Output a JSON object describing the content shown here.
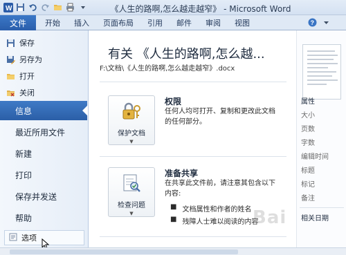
{
  "window": {
    "title": "《人生的路啊,怎么越走越窄》 - Microsoft Word"
  },
  "quick_access": [
    {
      "icon": "word-app-icon"
    },
    {
      "icon": "save-icon"
    },
    {
      "icon": "undo-icon"
    },
    {
      "icon": "redo-icon"
    },
    {
      "icon": "open-folder-icon"
    },
    {
      "icon": "print-icon"
    },
    {
      "icon": "customize-dropdown-icon"
    }
  ],
  "ribbon": {
    "file_tab": "文件",
    "tabs": [
      "开始",
      "插入",
      "页面布局",
      "引用",
      "邮件",
      "审阅",
      "视图"
    ]
  },
  "backstage_nav": {
    "commands": [
      {
        "label": "保存",
        "icon": "save-icon"
      },
      {
        "label": "另存为",
        "icon": "save-as-icon"
      },
      {
        "label": "打开",
        "icon": "open-folder-icon"
      },
      {
        "label": "关闭",
        "icon": "close-doc-icon"
      }
    ],
    "items": [
      "信息",
      "最近所用文件",
      "新建",
      "打印",
      "保存并发送",
      "帮助"
    ],
    "active": "信息",
    "options_label": "选项"
  },
  "info_panel": {
    "heading": "有关 《人生的路啊,怎么越...",
    "path": "F:\\文档\\《人生的路啊,怎么越走越窄》.docx",
    "sections": [
      {
        "button_label": "保护文档",
        "title": "权限",
        "description": "任何人均可打开、复制和更改此文档的任何部分。"
      },
      {
        "button_label": "检查问题",
        "title": "准备共享",
        "description": "在共享此文件前，请注意其包含以下内容:",
        "bullets": [
          "文档属性和作者的姓名",
          "残障人士难以阅读的内容"
        ]
      }
    ]
  },
  "properties": {
    "header": "属性",
    "items": [
      "大小",
      "页数",
      "字数",
      "编辑时间",
      "标题",
      "标记",
      "备注"
    ],
    "dates_header": "相关日期"
  },
  "watermark": "Bai"
}
